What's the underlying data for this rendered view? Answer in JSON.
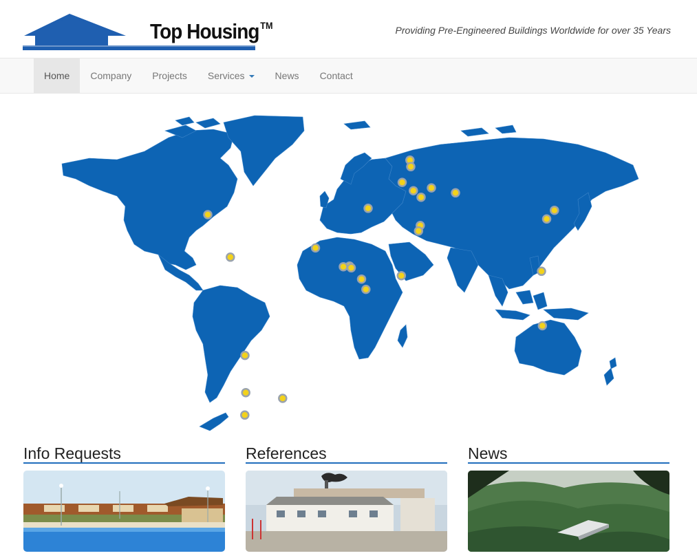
{
  "brand": {
    "name": "Top Housing",
    "trademark": "TM",
    "tagline": "Providing Pre-Engineered Buildings Worldwide for over 35 Years",
    "color": "#1f5fb0"
  },
  "nav": {
    "items": [
      {
        "label": "Home",
        "active": true
      },
      {
        "label": "Company",
        "active": false
      },
      {
        "label": "Projects",
        "active": false
      },
      {
        "label": "Services",
        "active": false,
        "dropdown": true
      },
      {
        "label": "News",
        "active": false
      },
      {
        "label": "Contact",
        "active": false
      }
    ]
  },
  "map": {
    "land_color": "#0d64b4",
    "marker_color": "#f3d21b",
    "marker_ring": "#9aa3ae",
    "projects": [
      {
        "lat": 30.0,
        "lon": -80.0
      },
      {
        "lat": 10.5,
        "lon": -66.9
      },
      {
        "lat": -34.6,
        "lon": -58.4
      },
      {
        "lat": -51.7,
        "lon": -57.9
      },
      {
        "lat": -54.3,
        "lon": -36.5
      },
      {
        "lat": -62.0,
        "lon": -58.5
      },
      {
        "lat": 14.7,
        "lon": -17.4
      },
      {
        "lat": 6.4,
        "lon": 2.4
      },
      {
        "lat": 6.1,
        "lon": -1.2
      },
      {
        "lat": 5.6,
        "lon": 3.4
      },
      {
        "lat": 0.4,
        "lon": 9.4
      },
      {
        "lat": -4.3,
        "lon": 11.9
      },
      {
        "lat": 2.0,
        "lon": 32.5
      },
      {
        "lat": 32.9,
        "lon": 13.2
      },
      {
        "lat": 55.0,
        "lon": 37.5
      },
      {
        "lat": 52.0,
        "lon": 38.0
      },
      {
        "lat": 44.8,
        "lon": 33.0
      },
      {
        "lat": 41.0,
        "lon": 39.5
      },
      {
        "lat": 42.3,
        "lon": 50.0
      },
      {
        "lat": 38.0,
        "lon": 44.0
      },
      {
        "lat": 40.0,
        "lon": 64.0
      },
      {
        "lat": 25.0,
        "lon": 43.5
      },
      {
        "lat": 22.5,
        "lon": 42.5
      },
      {
        "lat": 32.0,
        "lon": 121.5
      },
      {
        "lat": 28.0,
        "lon": 117.0
      },
      {
        "lat": 4.0,
        "lon": 114.0
      },
      {
        "lat": -21.0,
        "lon": 114.5
      }
    ]
  },
  "sections": [
    {
      "title": "Info Requests",
      "image": "resort-pool-photo"
    },
    {
      "title": "References",
      "image": "prefab-building-photo"
    },
    {
      "title": "News",
      "image": "forest-valley-photo"
    }
  ]
}
